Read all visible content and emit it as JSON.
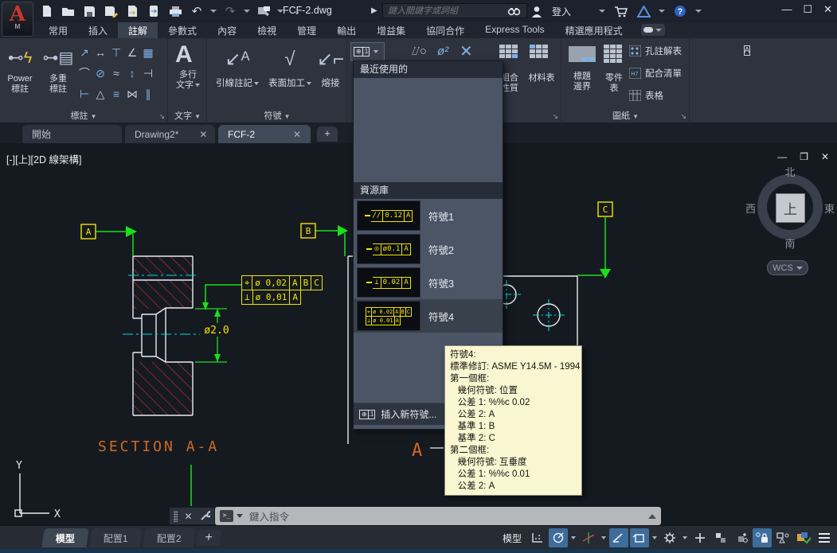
{
  "title_bar": {
    "doc_title": "FCF-2.dwg",
    "search_placeholder": "鍵入關鍵字或詞組",
    "sign_in_label": "登入"
  },
  "ribbon_tabs": {
    "items": [
      "常用",
      "插入",
      "註解",
      "參數式",
      "內容",
      "檢視",
      "管理",
      "輸出",
      "增益集",
      "協同合作",
      "Express Tools",
      "精選應用程式"
    ],
    "active": "註解"
  },
  "ribbon": {
    "dim_panel": {
      "power_dim": "Power\n標註",
      "multi_dim": "多重\n標註",
      "label": "標註"
    },
    "text_panel": {
      "mtext": "多行\n文字",
      "label": "文字"
    },
    "symbol_panel": {
      "leader_note": "引線註記",
      "surface_finish": "表面加工",
      "weld": "熔接",
      "label": "符號"
    },
    "bom_panel": {
      "assembly_props": "組合\n性質",
      "bom": "材料表",
      "label_visible": "料表"
    },
    "sheet_panel": {
      "title_border": "標題\n邊界",
      "parts_list": "零件\n表",
      "hole_chart": "孔註解表",
      "fit_list": "配合清單",
      "table": "表格",
      "label": "圖紙"
    }
  },
  "file_tabs": {
    "start": "開始",
    "drawing2": "Drawing2*",
    "fcf2": "FCF-2"
  },
  "viewport": {
    "label": "[-][上][2D 線架構]",
    "viewcube": {
      "north": "北",
      "south": "南",
      "west": "西",
      "east": "東",
      "top": "上"
    },
    "wcs": "WCS"
  },
  "drawing": {
    "datum_a": "A",
    "datum_b": "B",
    "datum_c": "C",
    "fcf_row1": [
      "⌖",
      "ø 0,02",
      "A",
      "B",
      "C"
    ],
    "fcf_row2": [
      "⊥",
      "ø 0,01",
      "A"
    ],
    "dim_label": "ø2.0",
    "section_label": "SECTION A-A",
    "section_arrow_label": "A"
  },
  "dropdown": {
    "recent_header": "最近使用的",
    "library_header": "資源庫",
    "items": [
      {
        "label": "符號1",
        "cells": [
          "//",
          "0.12",
          "A"
        ]
      },
      {
        "label": "符號2",
        "cells": [
          "◎",
          "ø0.1",
          "A"
        ]
      },
      {
        "label": "符號3",
        "cells": [
          "⊥",
          "0.02",
          "A"
        ]
      },
      {
        "label": "符號4",
        "row1": [
          "⌖",
          "ø 0.02",
          "A",
          "B",
          "C"
        ],
        "row2": [
          "⊥",
          "ø 0.01",
          "A"
        ]
      }
    ],
    "insert_label": "插入新符號..."
  },
  "tooltip": {
    "lines": [
      "符號4:",
      "標準修訂: ASME Y14.5M - 1994",
      "第一個框:",
      "   幾何符號: 位置",
      "   公差 1: %%c 0.02",
      "   公差 2: A",
      "   基準 1: B",
      "   基準 2: C",
      "第二個框:",
      "   幾何符號: 互垂度",
      "   公差 1: %%c 0.01",
      "   公差 2: A"
    ]
  },
  "command_line": {
    "prompt": "鍵入指令"
  },
  "status_bar": {
    "model_label": "模型"
  },
  "layout_tabs": {
    "model": "模型",
    "layout1": "配置1",
    "layout2": "配置2"
  }
}
